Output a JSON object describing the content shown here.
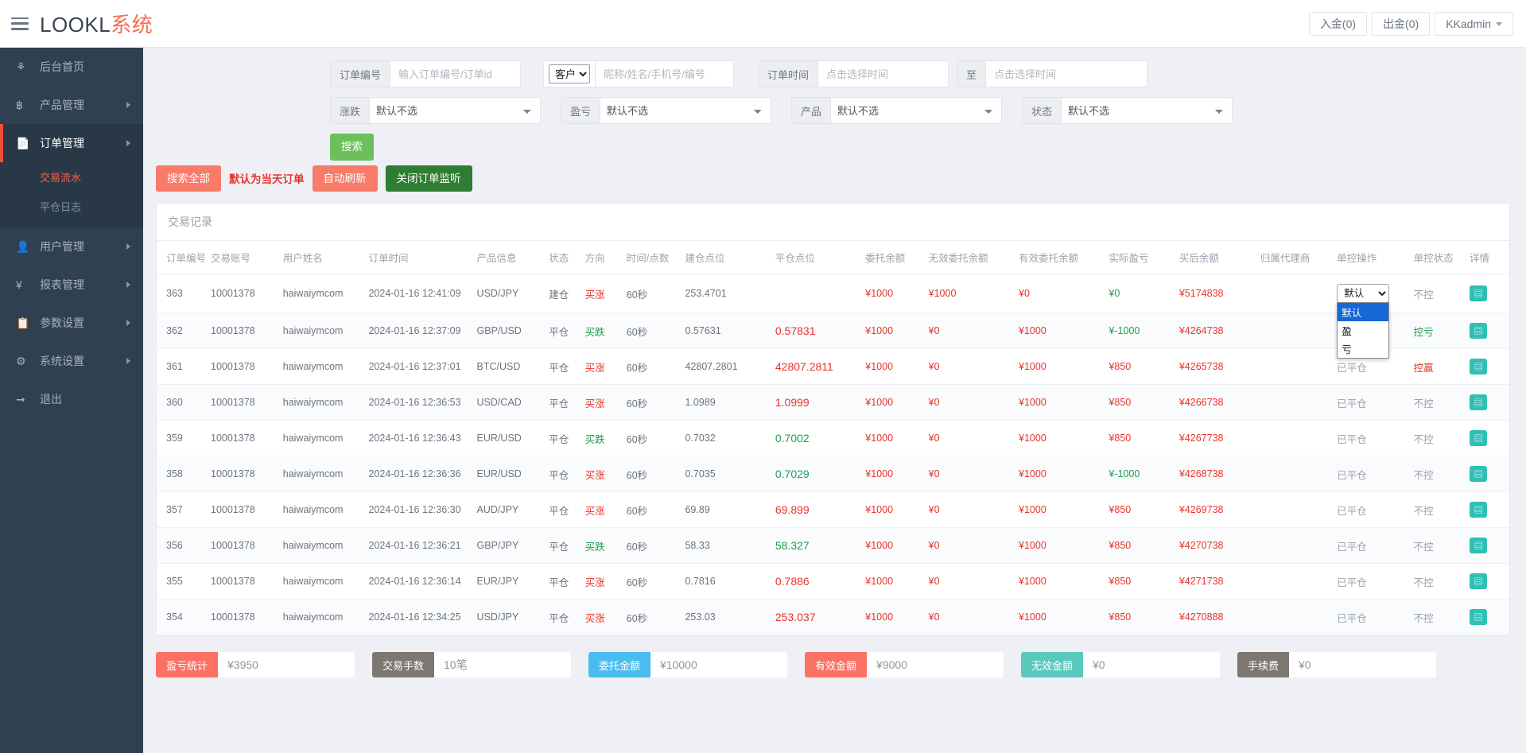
{
  "topbar": {
    "menu_icon": "hamburger-icon",
    "brand_en": "LOOKL",
    "brand_cn": "系统",
    "deposit_label": "入金(0)",
    "withdraw_label": "出金(0)",
    "user_label": "KKadmin"
  },
  "sidebar": {
    "items": [
      {
        "label": "后台首页",
        "icon": "dashboard-icon",
        "has_arrow": false,
        "active": false
      },
      {
        "label": "产品管理",
        "icon": "bitcoin-icon",
        "has_arrow": true,
        "active": false
      },
      {
        "label": "订单管理",
        "icon": "file-red-icon",
        "has_arrow": true,
        "active": true,
        "children": [
          {
            "label": "交易流水",
            "selected": true
          },
          {
            "label": "平仓日志",
            "selected": false
          }
        ]
      },
      {
        "label": "用户管理",
        "icon": "user-icon",
        "has_arrow": true,
        "active": false
      },
      {
        "label": "报表管理",
        "icon": "yen-icon",
        "has_arrow": true,
        "active": false
      },
      {
        "label": "参数设置",
        "icon": "copy-icon",
        "has_arrow": true,
        "active": false
      },
      {
        "label": "系统设置",
        "icon": "gears-icon",
        "has_arrow": true,
        "active": false
      },
      {
        "label": "退出",
        "icon": "logout-icon",
        "has_arrow": false,
        "active": false
      }
    ]
  },
  "filters": {
    "order_no": {
      "label": "订单编号",
      "placeholder": "输入订单编号/订单id",
      "value": ""
    },
    "customer": {
      "select_value": "客户",
      "select_options": [
        "客户"
      ],
      "placeholder": "昵称/姓名/手机号/编号",
      "value": ""
    },
    "order_time": {
      "label": "订单时间",
      "placeholder": "点击选择时间",
      "value": "",
      "to_label": "至",
      "placeholder2": "点击选择时间",
      "value2": ""
    },
    "rise_fall": {
      "label": "涨跌",
      "value": "默认不选",
      "options": [
        "默认不选"
      ]
    },
    "profit_loss": {
      "label": "盈亏",
      "value": "默认不选",
      "options": [
        "默认不选"
      ]
    },
    "product": {
      "label": "产品",
      "value": "默认不选",
      "options": [
        "默认不选"
      ]
    },
    "status": {
      "label": "状态",
      "value": "默认不选",
      "options": [
        "默认不选"
      ]
    },
    "search_button": "搜索"
  },
  "actions": {
    "search_all": "搜索全部",
    "hint": "默认为当天订单",
    "auto_refresh": "自动刷新",
    "close_monitor": "关闭订单监听"
  },
  "table": {
    "title": "交易记录",
    "columns": [
      "订单编号",
      "交易账号",
      "用户姓名",
      "订单时间",
      "产品信息",
      "状态",
      "方向",
      "时间/点数",
      "建仓点位",
      "平仓点位",
      "委托余额",
      "无效委托余额",
      "有效委托余额",
      "实际盈亏",
      "买后余额",
      "归属代理商",
      "单控操作",
      "单控状态",
      "详情"
    ],
    "rows": [
      {
        "id": "363",
        "account": "10001378",
        "user": "haiwaiymcom",
        "time": "2024-01-16 12:41:09",
        "product": "USD/JPY",
        "status": "建仓",
        "dir": "买涨",
        "dir_color": "red",
        "duration": "60秒",
        "open": "253.4701",
        "close": "",
        "close_color": "",
        "entrust": "¥1000",
        "invalid_entrust": "¥1000",
        "valid_entrust": "¥0",
        "valid_color": "red",
        "pnl": "¥0",
        "pnl_color": "green",
        "balance": "¥5174838",
        "agent": "",
        "ctrl": "默认",
        "ctrl_open": true,
        "ctrl_options": [
          "默认",
          "盈",
          "亏"
        ],
        "ctrl_status": "不控",
        "ctrl_status_color": "grey",
        "detail": "detail-icon"
      },
      {
        "id": "362",
        "account": "10001378",
        "user": "haiwaiymcom",
        "time": "2024-01-16 12:37:09",
        "product": "GBP/USD",
        "status": "平仓",
        "dir": "买跌",
        "dir_color": "green",
        "duration": "60秒",
        "open": "0.57631",
        "close": "0.57831",
        "close_color": "red",
        "entrust": "¥1000",
        "invalid_entrust": "¥0",
        "valid_entrust": "¥1000",
        "valid_color": "red",
        "pnl": "¥-1000",
        "pnl_color": "green",
        "balance": "¥4264738",
        "agent": "",
        "ctrl": "",
        "ctrl_open": false,
        "ctrl_options": [],
        "ctrl_status": "控亏",
        "ctrl_status_color": "green",
        "detail": "detail-icon"
      },
      {
        "id": "361",
        "account": "10001378",
        "user": "haiwaiymcom",
        "time": "2024-01-16 12:37:01",
        "product": "BTC/USD",
        "status": "平仓",
        "dir": "买涨",
        "dir_color": "red",
        "duration": "60秒",
        "open": "42807.2801",
        "close": "42807.2811",
        "close_color": "red",
        "entrust": "¥1000",
        "invalid_entrust": "¥0",
        "valid_entrust": "¥1000",
        "valid_color": "red",
        "pnl": "¥850",
        "pnl_color": "red",
        "balance": "¥4265738",
        "agent": "",
        "ctrl": "已平仓",
        "ctrl_open": false,
        "ctrl_options": [],
        "ctrl_status": "控赢",
        "ctrl_status_color": "red",
        "detail": "detail-icon"
      },
      {
        "id": "360",
        "account": "10001378",
        "user": "haiwaiymcom",
        "time": "2024-01-16 12:36:53",
        "product": "USD/CAD",
        "status": "平仓",
        "dir": "买涨",
        "dir_color": "red",
        "duration": "60秒",
        "open": "1.0989",
        "close": "1.0999",
        "close_color": "red",
        "entrust": "¥1000",
        "invalid_entrust": "¥0",
        "valid_entrust": "¥1000",
        "valid_color": "red",
        "pnl": "¥850",
        "pnl_color": "red",
        "balance": "¥4266738",
        "agent": "",
        "ctrl": "已平仓",
        "ctrl_open": false,
        "ctrl_options": [],
        "ctrl_status": "不控",
        "ctrl_status_color": "grey",
        "detail": "detail-icon"
      },
      {
        "id": "359",
        "account": "10001378",
        "user": "haiwaiymcom",
        "time": "2024-01-16 12:36:43",
        "product": "EUR/USD",
        "status": "平仓",
        "dir": "买跌",
        "dir_color": "green",
        "duration": "60秒",
        "open": "0.7032",
        "close": "0.7002",
        "close_color": "green",
        "entrust": "¥1000",
        "invalid_entrust": "¥0",
        "valid_entrust": "¥1000",
        "valid_color": "red",
        "pnl": "¥850",
        "pnl_color": "red",
        "balance": "¥4267738",
        "agent": "",
        "ctrl": "已平仓",
        "ctrl_open": false,
        "ctrl_options": [],
        "ctrl_status": "不控",
        "ctrl_status_color": "grey",
        "detail": "detail-icon"
      },
      {
        "id": "358",
        "account": "10001378",
        "user": "haiwaiymcom",
        "time": "2024-01-16 12:36:36",
        "product": "EUR/USD",
        "status": "平仓",
        "dir": "买涨",
        "dir_color": "red",
        "duration": "60秒",
        "open": "0.7035",
        "close": "0.7029",
        "close_color": "green",
        "entrust": "¥1000",
        "invalid_entrust": "¥0",
        "valid_entrust": "¥1000",
        "valid_color": "red",
        "pnl": "¥-1000",
        "pnl_color": "green",
        "balance": "¥4268738",
        "agent": "",
        "ctrl": "已平仓",
        "ctrl_open": false,
        "ctrl_options": [],
        "ctrl_status": "不控",
        "ctrl_status_color": "grey",
        "detail": "detail-icon"
      },
      {
        "id": "357",
        "account": "10001378",
        "user": "haiwaiymcom",
        "time": "2024-01-16 12:36:30",
        "product": "AUD/JPY",
        "status": "平仓",
        "dir": "买涨",
        "dir_color": "red",
        "duration": "60秒",
        "open": "69.89",
        "close": "69.899",
        "close_color": "red",
        "entrust": "¥1000",
        "invalid_entrust": "¥0",
        "valid_entrust": "¥1000",
        "valid_color": "red",
        "pnl": "¥850",
        "pnl_color": "red",
        "balance": "¥4269738",
        "agent": "",
        "ctrl": "已平仓",
        "ctrl_open": false,
        "ctrl_options": [],
        "ctrl_status": "不控",
        "ctrl_status_color": "grey",
        "detail": "detail-icon"
      },
      {
        "id": "356",
        "account": "10001378",
        "user": "haiwaiymcom",
        "time": "2024-01-16 12:36:21",
        "product": "GBP/JPY",
        "status": "平仓",
        "dir": "买跌",
        "dir_color": "green",
        "duration": "60秒",
        "open": "58.33",
        "close": "58.327",
        "close_color": "green",
        "entrust": "¥1000",
        "invalid_entrust": "¥0",
        "valid_entrust": "¥1000",
        "valid_color": "red",
        "pnl": "¥850",
        "pnl_color": "red",
        "balance": "¥4270738",
        "agent": "",
        "ctrl": "已平仓",
        "ctrl_open": false,
        "ctrl_options": [],
        "ctrl_status": "不控",
        "ctrl_status_color": "grey",
        "detail": "detail-icon"
      },
      {
        "id": "355",
        "account": "10001378",
        "user": "haiwaiymcom",
        "time": "2024-01-16 12:36:14",
        "product": "EUR/JPY",
        "status": "平仓",
        "dir": "买涨",
        "dir_color": "red",
        "duration": "60秒",
        "open": "0.7816",
        "close": "0.7886",
        "close_color": "red",
        "entrust": "¥1000",
        "invalid_entrust": "¥0",
        "valid_entrust": "¥1000",
        "valid_color": "red",
        "pnl": "¥850",
        "pnl_color": "red",
        "balance": "¥4271738",
        "agent": "",
        "ctrl": "已平仓",
        "ctrl_open": false,
        "ctrl_options": [],
        "ctrl_status": "不控",
        "ctrl_status_color": "grey",
        "detail": "detail-icon"
      },
      {
        "id": "354",
        "account": "10001378",
        "user": "haiwaiymcom",
        "time": "2024-01-16 12:34:25",
        "product": "USD/JPY",
        "status": "平仓",
        "dir": "买涨",
        "dir_color": "red",
        "duration": "60秒",
        "open": "253.03",
        "close": "253.037",
        "close_color": "red",
        "entrust": "¥1000",
        "invalid_entrust": "¥0",
        "valid_entrust": "¥1000",
        "valid_color": "red",
        "pnl": "¥850",
        "pnl_color": "red",
        "balance": "¥4270888",
        "agent": "",
        "ctrl": "已平仓",
        "ctrl_open": false,
        "ctrl_options": [],
        "ctrl_status": "不控",
        "ctrl_status_color": "grey",
        "detail": "detail-icon"
      }
    ]
  },
  "summary": [
    {
      "label": "盈亏统计",
      "value": "¥3950",
      "color": "#fb7265"
    },
    {
      "label": "交易手数",
      "value": "10笔",
      "color": "#7d7771"
    },
    {
      "label": "委托金额",
      "value": "¥10000",
      "color": "#49bdf0"
    },
    {
      "label": "有效金额",
      "value": "¥9000",
      "color": "#fb7265"
    },
    {
      "label": "无效金额",
      "value": "¥0",
      "color": "#5ac9bd"
    },
    {
      "label": "手续费",
      "value": "¥0",
      "color": "#7d7771"
    }
  ]
}
